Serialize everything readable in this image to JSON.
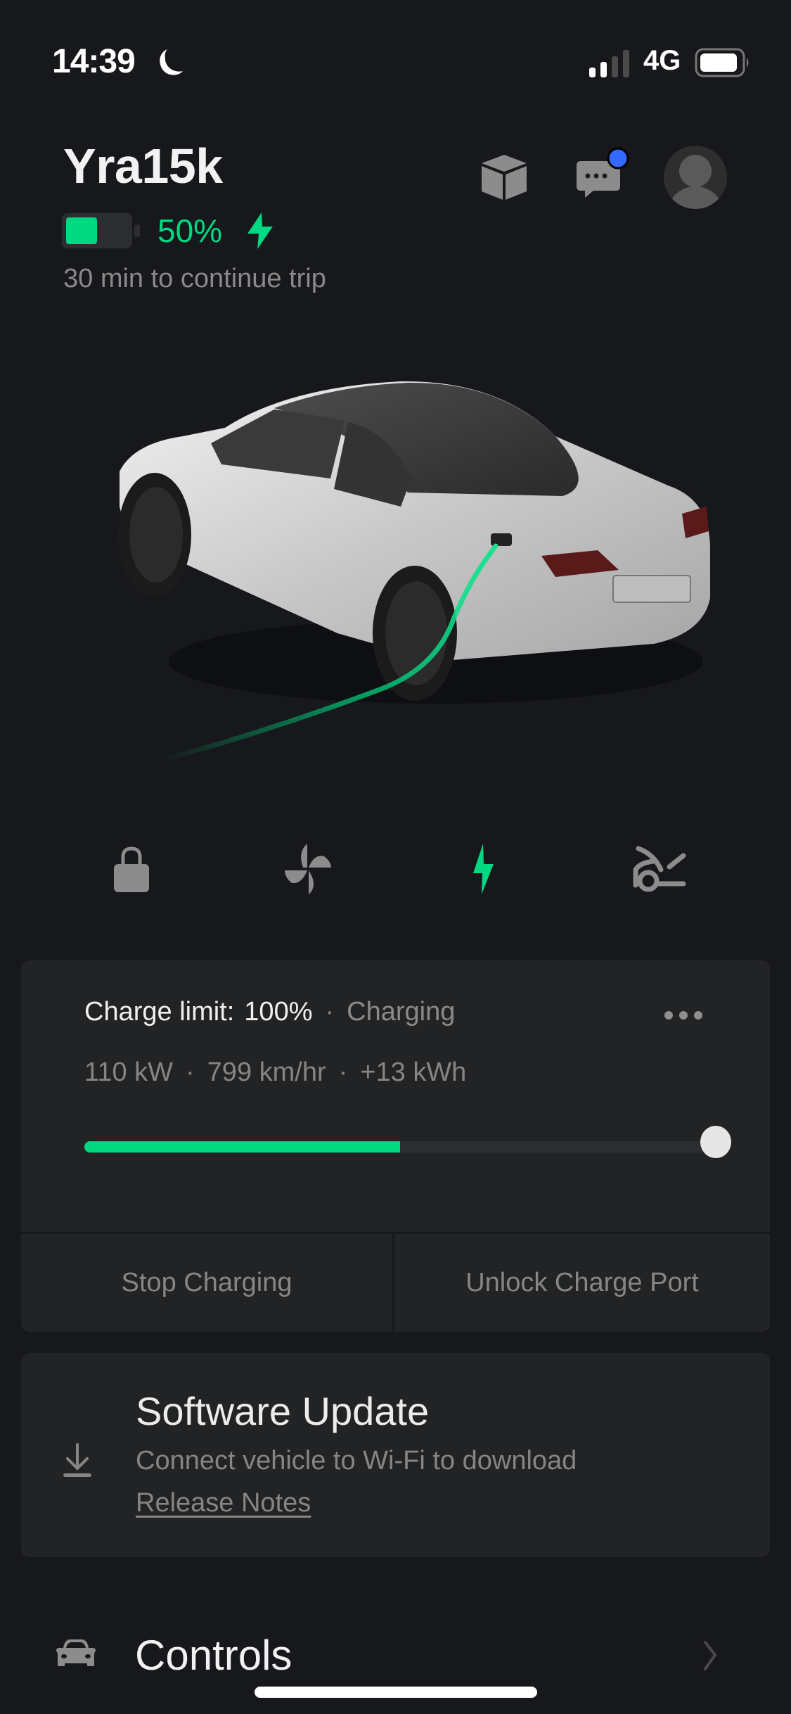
{
  "status_bar": {
    "time": "14:39",
    "focus_icon": "moon-icon",
    "network": "4G",
    "signal_bars_active": 2,
    "signal_bars_total": 4
  },
  "header": {
    "car_name": "Yra15k",
    "battery_percent_label": "50%",
    "battery_level": 0.5,
    "charging_icon": "bolt-icon",
    "trip_text": "30 min to continue trip",
    "icons": [
      "cube-icon",
      "chat-icon",
      "avatar-icon"
    ],
    "chat_has_notification": true
  },
  "quick_controls": [
    {
      "name": "lock",
      "icon": "lock-icon",
      "active": false
    },
    {
      "name": "climate",
      "icon": "fan-icon",
      "active": false
    },
    {
      "name": "charging",
      "icon": "bolt-icon",
      "active": true
    },
    {
      "name": "frunk",
      "icon": "frunk-icon",
      "active": false
    }
  ],
  "charge_card": {
    "limit_label": "Charge limit:",
    "limit_value": "100%",
    "status": "Charging",
    "power": "110 kW",
    "rate": "799 km/hr",
    "energy_added": "+13 kWh",
    "separator": "·",
    "current_charge": 0.5,
    "charge_limit": 1.0,
    "actions": {
      "stop": "Stop Charging",
      "unlock": "Unlock Charge Port"
    }
  },
  "software_update": {
    "title": "Software Update",
    "subtitle": "Connect vehicle to Wi-Fi to download",
    "link": "Release Notes"
  },
  "controls_row": {
    "label": "Controls"
  },
  "colors": {
    "accent_green": "#00d882",
    "notification_blue": "#3369ff",
    "background": "#17181b",
    "card": "#222325"
  }
}
